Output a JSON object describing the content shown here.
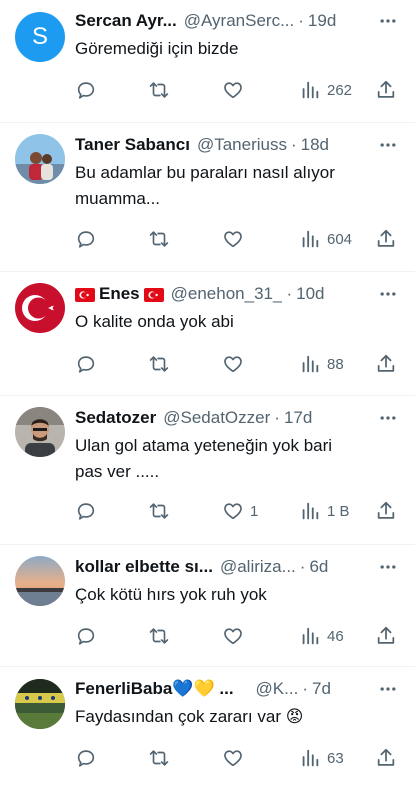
{
  "icons": {
    "reply": "reply-icon",
    "retweet": "retweet-icon",
    "like": "heart-icon",
    "views": "views-icon",
    "share": "share-icon",
    "more": "more-icon"
  },
  "colors": {
    "secondary_text": "#536471",
    "divider": "#eff3f4",
    "avatar_default": "#1d9bf0"
  },
  "tweets": [
    {
      "name": "Sercan Ayr...",
      "handle": "@AyranSerc...",
      "time": "19d",
      "text": "Göremediği için bizde",
      "avatar_initial": "S",
      "likes": "",
      "views": "262"
    },
    {
      "name": "Taner Sabancı",
      "handle": "@Taneriuss",
      "time": "18d",
      "text": "Bu adamlar bu paraları nasıl alıyor\nmuamma...",
      "likes": "",
      "views": "604"
    },
    {
      "name": "Enes",
      "handle": "@enehon_31_",
      "time": "10d",
      "text": "O kalite onda yok abi",
      "likes": "",
      "views": "88"
    },
    {
      "name": "Sedatozer",
      "handle": "@SedatOzzer",
      "time": "17d",
      "text": "Ulan gol atama yeteneğin yok bari\npas ver .....",
      "likes": "1",
      "views": "1 B"
    },
    {
      "name": "kollar elbette sı...",
      "handle": "@alirizа...",
      "time": "6d",
      "text": "Çok kötü hırs yok ruh yok",
      "likes": "",
      "views": "46"
    },
    {
      "name": "FenerliBaba💙💛 ...",
      "handle": "@K...",
      "time": "7d",
      "text": "Faydasından çok zararı var 😡",
      "likes": "",
      "views": "63"
    }
  ],
  "separator": "·"
}
